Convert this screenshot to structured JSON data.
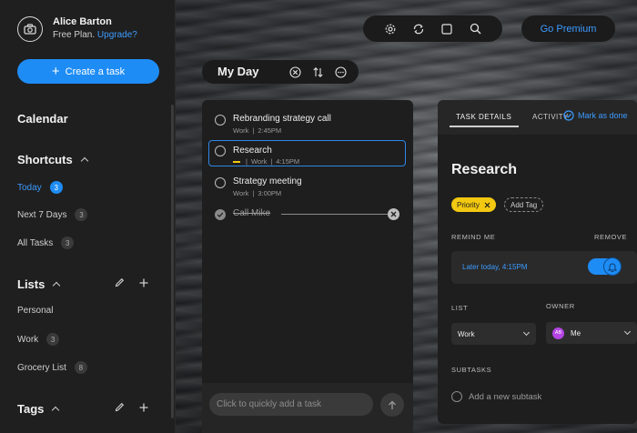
{
  "user": {
    "name": "Alice Barton",
    "plan": "Free Plan.",
    "upgrade": "Upgrade?"
  },
  "create_task": "Create a task",
  "calendar": {
    "title": "Calendar"
  },
  "shortcuts": {
    "title": "Shortcuts",
    "items": [
      {
        "label": "Today",
        "count": "3"
      },
      {
        "label": "Next 7 Days",
        "count": "3"
      },
      {
        "label": "All Tasks",
        "count": "3"
      }
    ]
  },
  "lists": {
    "title": "Lists",
    "items": [
      {
        "label": "Personal",
        "count": ""
      },
      {
        "label": "Work",
        "count": "3"
      },
      {
        "label": "Grocery List",
        "count": "8"
      }
    ]
  },
  "tags": {
    "title": "Tags"
  },
  "premium": "Go Premium",
  "myday": {
    "title": "My Day"
  },
  "tasks": [
    {
      "name": "Rebranding strategy call",
      "list": "Work",
      "sep": "|",
      "time": "2:45PM"
    },
    {
      "name": "Research",
      "list": "Work",
      "sep": "|",
      "time": "4:15PM"
    },
    {
      "name": "Strategy meeting",
      "list": "Work",
      "sep": "|",
      "time": "3:00PM"
    },
    {
      "name": "Call Mike"
    }
  ],
  "quick_add_placeholder": "Click to quickly add a task",
  "details": {
    "tab_details": "TASK DETAILS",
    "tab_activity": "ACTIVITY",
    "mark_done": "Mark as done",
    "title": "Research",
    "tag_priority": "Priority",
    "tag_add": "Add Tag",
    "remind_label": "REMIND ME",
    "remove_label": "REMOVE",
    "remind_value": "Later today, 4:15PM",
    "list_label": "LIST",
    "list_value": "Work",
    "owner_label": "OWNER",
    "owner_initials": "AB",
    "owner_value": "Me",
    "subtasks_label": "SUBTASKS",
    "add_subtask": "Add a new subtask"
  },
  "colors": {
    "accent": "#1e8cf5",
    "priority": "#f2c811",
    "owner_avatar": "#b445e3"
  },
  "icons": [
    "camera-icon",
    "gear-icon",
    "sync-icon",
    "square-icon",
    "search-icon",
    "close-circle-icon",
    "sort-icon",
    "more-icon",
    "pencil-icon",
    "plus-icon",
    "send-icon",
    "bell-icon",
    "check-icon"
  ]
}
